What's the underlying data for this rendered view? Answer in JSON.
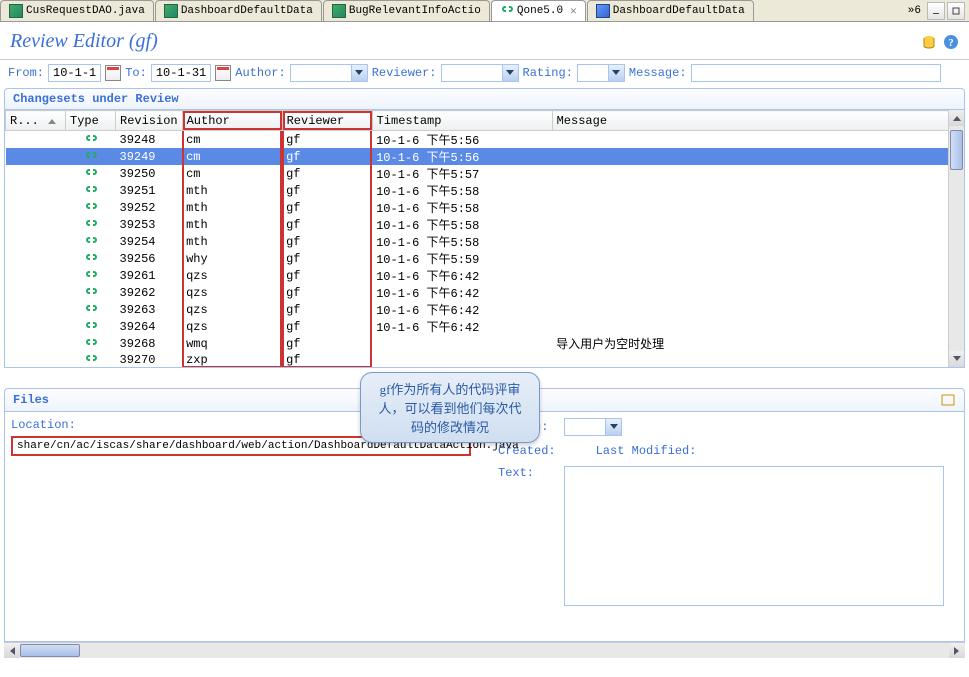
{
  "tabs": [
    {
      "label": "CusRequestDAO.java",
      "icon": "j"
    },
    {
      "label": "DashboardDefaultData",
      "icon": "j"
    },
    {
      "label": "BugRelevantInfoActio",
      "icon": "j"
    },
    {
      "label": "Qone5.0",
      "icon": "chain",
      "active": true
    },
    {
      "label": "DashboardDefaultData",
      "icon": "d"
    }
  ],
  "tab_overflow": "»6",
  "title": "Review Editor (gf)",
  "filter": {
    "from_label": "From:",
    "from_value": "10-1-1",
    "to_label": "To:",
    "to_value": "10-1-31",
    "author_label": "Author:",
    "reviewer_label": "Reviewer:",
    "rating_label": "Rating:",
    "message_label": "Message:"
  },
  "changesets": {
    "header": "Changesets under Review",
    "columns": {
      "r": "R...",
      "type": "Type",
      "revision": "Revision",
      "author": "Author",
      "reviewer": "Reviewer",
      "timestamp": "Timestamp",
      "message": "Message"
    },
    "rows": [
      {
        "rev": "39248",
        "author": "cm",
        "reviewer": "gf",
        "ts": "10-1-6 下午5:56",
        "msg": ""
      },
      {
        "rev": "39249",
        "author": "cm",
        "reviewer": "gf",
        "ts": "10-1-6 下午5:56",
        "msg": "",
        "selected": true
      },
      {
        "rev": "39250",
        "author": "cm",
        "reviewer": "gf",
        "ts": "10-1-6 下午5:57",
        "msg": ""
      },
      {
        "rev": "39251",
        "author": "mth",
        "reviewer": "gf",
        "ts": "10-1-6 下午5:58",
        "msg": ""
      },
      {
        "rev": "39252",
        "author": "mth",
        "reviewer": "gf",
        "ts": "10-1-6 下午5:58",
        "msg": ""
      },
      {
        "rev": "39253",
        "author": "mth",
        "reviewer": "gf",
        "ts": "10-1-6 下午5:58",
        "msg": ""
      },
      {
        "rev": "39254",
        "author": "mth",
        "reviewer": "gf",
        "ts": "10-1-6 下午5:58",
        "msg": ""
      },
      {
        "rev": "39256",
        "author": "why",
        "reviewer": "gf",
        "ts": "10-1-6 下午5:59",
        "msg": ""
      },
      {
        "rev": "39261",
        "author": "qzs",
        "reviewer": "gf",
        "ts": "10-1-6 下午6:42",
        "msg": ""
      },
      {
        "rev": "39262",
        "author": "qzs",
        "reviewer": "gf",
        "ts": "10-1-6 下午6:42",
        "msg": ""
      },
      {
        "rev": "39263",
        "author": "qzs",
        "reviewer": "gf",
        "ts": "10-1-6 下午6:42",
        "msg": ""
      },
      {
        "rev": "39264",
        "author": "qzs",
        "reviewer": "gf",
        "ts": "10-1-6 下午6:42",
        "msg": ""
      },
      {
        "rev": "39268",
        "author": "wmq",
        "reviewer": "gf",
        "ts": "",
        "msg": "导入用户为空时处理"
      },
      {
        "rev": "39270",
        "author": "zxp",
        "reviewer": "gf",
        "ts": "",
        "msg": ""
      }
    ]
  },
  "callout": "gf作为所有人的代码评审人，可以看到他们每次代码的修改情况",
  "files": {
    "header": "Files",
    "location_label": "Location:",
    "location_value": "share/cn/ac/iscas/share/dashboard/web/action/DashboardDefaultDataAction.java",
    "rating_label": "Rating:",
    "created_label": "Created:",
    "modified_label": "Last Modified:",
    "text_label": "Text:"
  }
}
